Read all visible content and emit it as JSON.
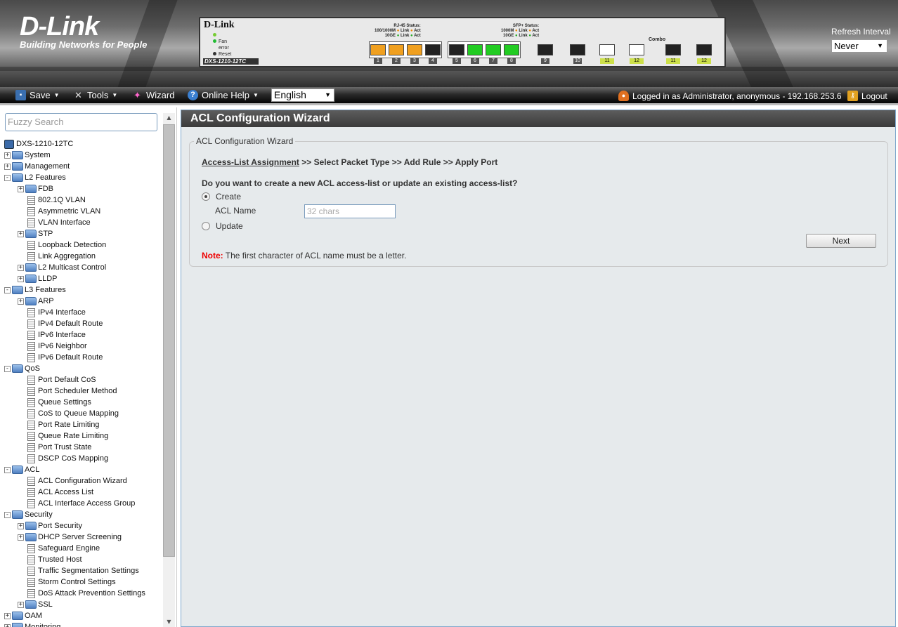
{
  "banner": {
    "logo_text": "D-Link",
    "logo_tagline": "Building Networks for People",
    "device": {
      "brand": "D-Link",
      "model": "DXS-1210-12TC",
      "led_fan_label": "Fan",
      "led_error_label": "error",
      "led_reset_label": "Reset",
      "rj45_status_label": "RJ-45 Status:",
      "rj45_100_label": "100/1000M",
      "rj45_10g_label": "10GE",
      "sfp_status_label": "SFP+ Status:",
      "sfp_1000_label": "1000M",
      "sfp_10g_label": "10GE",
      "link_label": "Link",
      "act_label": "Act",
      "combo_label": "Combo",
      "ports": [
        "1",
        "2",
        "3",
        "4",
        "5",
        "6",
        "7",
        "8",
        "9",
        "10",
        "11",
        "12",
        "11",
        "12"
      ]
    },
    "refresh_label": "Refresh Interval",
    "refresh_value": "Never"
  },
  "toolbar": {
    "save_label": "Save",
    "tools_label": "Tools",
    "wizard_label": "Wizard",
    "help_label": "Online Help",
    "language_value": "English",
    "login_info": "Logged in as Administrator, anonymous - 192.168.253.6",
    "logout_label": "Logout"
  },
  "sidebar": {
    "search_placeholder": "Fuzzy Search",
    "root": "DXS-1210-12TC",
    "tree": [
      {
        "label": "System",
        "level": 0,
        "kind": "folder",
        "expander": "+"
      },
      {
        "label": "Management",
        "level": 0,
        "kind": "folder",
        "expander": "+"
      },
      {
        "label": "L2 Features",
        "level": 0,
        "kind": "folder",
        "expander": "-"
      },
      {
        "label": "FDB",
        "level": 1,
        "kind": "folder",
        "expander": "+"
      },
      {
        "label": "802.1Q VLAN",
        "level": 1,
        "kind": "page"
      },
      {
        "label": "Asymmetric VLAN",
        "level": 1,
        "kind": "page"
      },
      {
        "label": "VLAN Interface",
        "level": 1,
        "kind": "page"
      },
      {
        "label": "STP",
        "level": 1,
        "kind": "folder",
        "expander": "+"
      },
      {
        "label": "Loopback Detection",
        "level": 1,
        "kind": "page"
      },
      {
        "label": "Link Aggregation",
        "level": 1,
        "kind": "page"
      },
      {
        "label": "L2 Multicast Control",
        "level": 1,
        "kind": "folder",
        "expander": "+"
      },
      {
        "label": "LLDP",
        "level": 1,
        "kind": "folder",
        "expander": "+"
      },
      {
        "label": "L3 Features",
        "level": 0,
        "kind": "folder",
        "expander": "-"
      },
      {
        "label": "ARP",
        "level": 1,
        "kind": "folder",
        "expander": "+"
      },
      {
        "label": "IPv4 Interface",
        "level": 1,
        "kind": "page"
      },
      {
        "label": "IPv4 Default Route",
        "level": 1,
        "kind": "page"
      },
      {
        "label": "IPv6 Interface",
        "level": 1,
        "kind": "page"
      },
      {
        "label": "IPv6 Neighbor",
        "level": 1,
        "kind": "page"
      },
      {
        "label": "IPv6 Default Route",
        "level": 1,
        "kind": "page"
      },
      {
        "label": "QoS",
        "level": 0,
        "kind": "folder",
        "expander": "-"
      },
      {
        "label": "Port Default CoS",
        "level": 1,
        "kind": "page"
      },
      {
        "label": "Port Scheduler Method",
        "level": 1,
        "kind": "page"
      },
      {
        "label": "Queue Settings",
        "level": 1,
        "kind": "page"
      },
      {
        "label": "CoS to Queue Mapping",
        "level": 1,
        "kind": "page"
      },
      {
        "label": "Port Rate Limiting",
        "level": 1,
        "kind": "page"
      },
      {
        "label": "Queue Rate Limiting",
        "level": 1,
        "kind": "page"
      },
      {
        "label": "Port Trust State",
        "level": 1,
        "kind": "page"
      },
      {
        "label": "DSCP CoS Mapping",
        "level": 1,
        "kind": "page"
      },
      {
        "label": "ACL",
        "level": 0,
        "kind": "folder",
        "expander": "-"
      },
      {
        "label": "ACL Configuration Wizard",
        "level": 1,
        "kind": "page"
      },
      {
        "label": "ACL Access List",
        "level": 1,
        "kind": "page"
      },
      {
        "label": "ACL Interface Access Group",
        "level": 1,
        "kind": "page"
      },
      {
        "label": "Security",
        "level": 0,
        "kind": "folder",
        "expander": "-"
      },
      {
        "label": "Port Security",
        "level": 1,
        "kind": "folder",
        "expander": "+"
      },
      {
        "label": "DHCP Server Screening",
        "level": 1,
        "kind": "folder",
        "expander": "+"
      },
      {
        "label": "Safeguard Engine",
        "level": 1,
        "kind": "page"
      },
      {
        "label": "Trusted Host",
        "level": 1,
        "kind": "page"
      },
      {
        "label": "Traffic Segmentation Settings",
        "level": 1,
        "kind": "page"
      },
      {
        "label": "Storm Control Settings",
        "level": 1,
        "kind": "page"
      },
      {
        "label": "DoS Attack Prevention Settings",
        "level": 1,
        "kind": "page"
      },
      {
        "label": "SSL",
        "level": 1,
        "kind": "folder",
        "expander": "+"
      },
      {
        "label": "OAM",
        "level": 0,
        "kind": "folder",
        "expander": "+"
      },
      {
        "label": "Monitoring",
        "level": 0,
        "kind": "folder",
        "expander": "+"
      }
    ]
  },
  "main": {
    "page_title": "ACL Configuration Wizard",
    "fieldset_legend": "ACL Configuration Wizard",
    "steps": {
      "current": "Access-List Assignment",
      "rest": ">> Select Packet Type >> Add Rule >> Apply Port"
    },
    "question": "Do you want to create a new ACL access-list or update an existing access-list?",
    "create_label": "Create",
    "acl_name_label": "ACL Name",
    "acl_name_placeholder": "32 chars",
    "update_label": "Update",
    "next_label": "Next",
    "note_prefix": "Note:",
    "note_text": "The first character of ACL name must be a letter."
  }
}
